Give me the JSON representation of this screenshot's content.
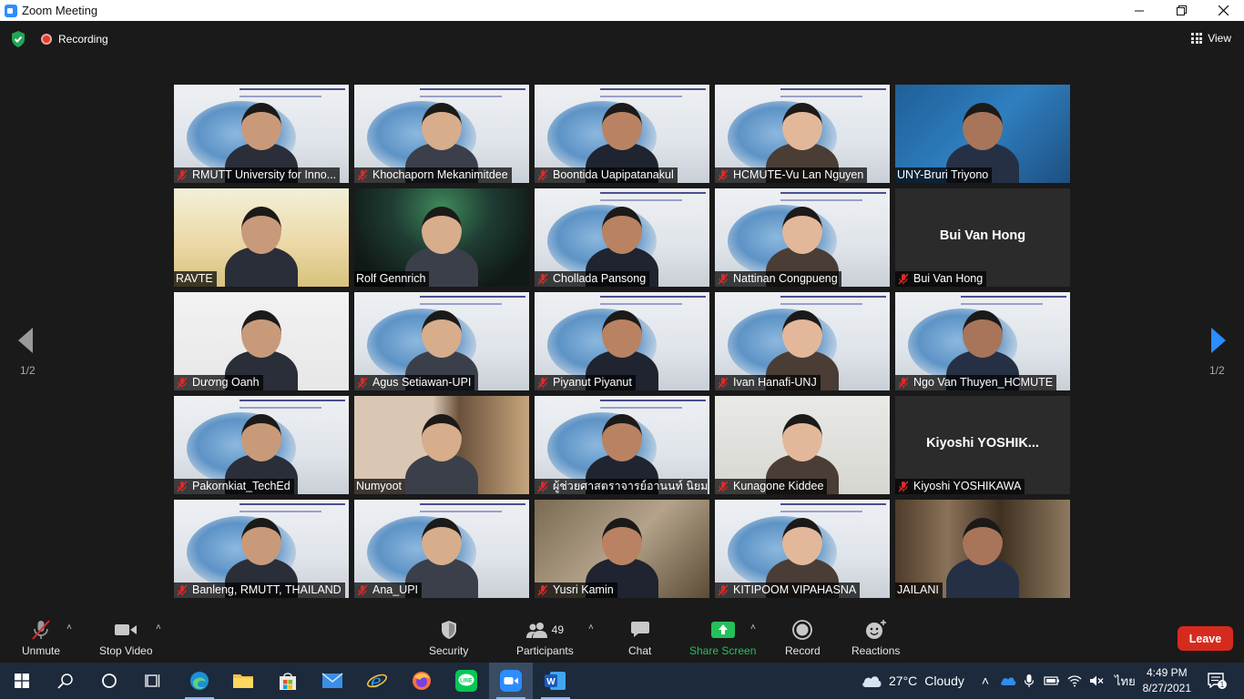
{
  "window": {
    "title": "Zoom Meeting"
  },
  "top": {
    "recording_label": "Recording",
    "view_label": "View"
  },
  "pagination": {
    "left": "1/2",
    "right": "1/2"
  },
  "participants": [
    {
      "name": "RMUTT University for Inno...",
      "muted": true,
      "bg": "slide"
    },
    {
      "name": "Khochaporn Mekanimitdee",
      "muted": true,
      "bg": "slide"
    },
    {
      "name": "Boontida Uapipatanakul",
      "muted": true,
      "bg": "slide"
    },
    {
      "name": "HCMUTE-Vu Lan Nguyen",
      "muted": true,
      "bg": "slide"
    },
    {
      "name": "UNY-Bruri Triyono",
      "muted": false,
      "bg": "blue"
    },
    {
      "name": "RAVTE",
      "muted": false,
      "bg": "flags"
    },
    {
      "name": "Rolf Gennrich",
      "muted": false,
      "bg": "aurora"
    },
    {
      "name": "Chollada Pansong",
      "muted": true,
      "bg": "slide"
    },
    {
      "name": "Nattinan Congpueng",
      "muted": true,
      "bg": "slide"
    },
    {
      "name": "Bui Van Hong",
      "muted": true,
      "bg": "none",
      "display_name": "Bui Van Hong"
    },
    {
      "name": "Dương Oanh",
      "muted": true,
      "bg": "plain"
    },
    {
      "name": "Agus Setiawan-UPI",
      "muted": true,
      "bg": "slide"
    },
    {
      "name": "Piyanut Piyanut",
      "muted": true,
      "bg": "slide"
    },
    {
      "name": "Ivan Hanafi-UNJ",
      "muted": true,
      "bg": "slide"
    },
    {
      "name": "Ngo Van Thuyen_HCMUTE",
      "muted": true,
      "bg": "slide"
    },
    {
      "name": "Pakornkiat_TechEd",
      "muted": true,
      "bg": "slide"
    },
    {
      "name": "Numyoot",
      "muted": false,
      "bg": "room",
      "active": true
    },
    {
      "name": "ผู้ช่วยศาสตราจารย์อานนท์ นิยม...",
      "muted": true,
      "bg": "slide2"
    },
    {
      "name": "Kunagone Kiddee",
      "muted": true,
      "bg": "office"
    },
    {
      "name": "Kiyoshi YOSHIKAWA",
      "muted": true,
      "bg": "none",
      "display_name": "Kiyoshi  YOSHIK..."
    },
    {
      "name": "Banleng, RMUTT, THAILAND",
      "muted": true,
      "bg": "slide"
    },
    {
      "name": "Ana_UPI",
      "muted": true,
      "bg": "slide"
    },
    {
      "name": "Yusri Kamin",
      "muted": true,
      "bg": "home"
    },
    {
      "name": "KITIPOOM VIPAHASNA",
      "muted": true,
      "bg": "slide"
    },
    {
      "name": "JAILANI",
      "muted": false,
      "bg": "cabinet"
    }
  ],
  "toolbar": {
    "unmute": "Unmute",
    "stop_video": "Stop Video",
    "security": "Security",
    "participants": "Participants",
    "participants_count": "49",
    "chat": "Chat",
    "share_screen": "Share Screen",
    "record": "Record",
    "reactions": "Reactions",
    "leave": "Leave"
  },
  "taskbar": {
    "weather_temp": "27°C",
    "weather_desc": "Cloudy",
    "language": "ไทย",
    "time": "4:49 PM",
    "date": "8/27/2021",
    "notification_count": "1"
  },
  "colors": {
    "accent_blue": "#2d8cff",
    "leave_red": "#d52b1e",
    "share_green": "#25c05a",
    "mute_red": "#e02828",
    "active_speaker": "#b8d13a"
  }
}
